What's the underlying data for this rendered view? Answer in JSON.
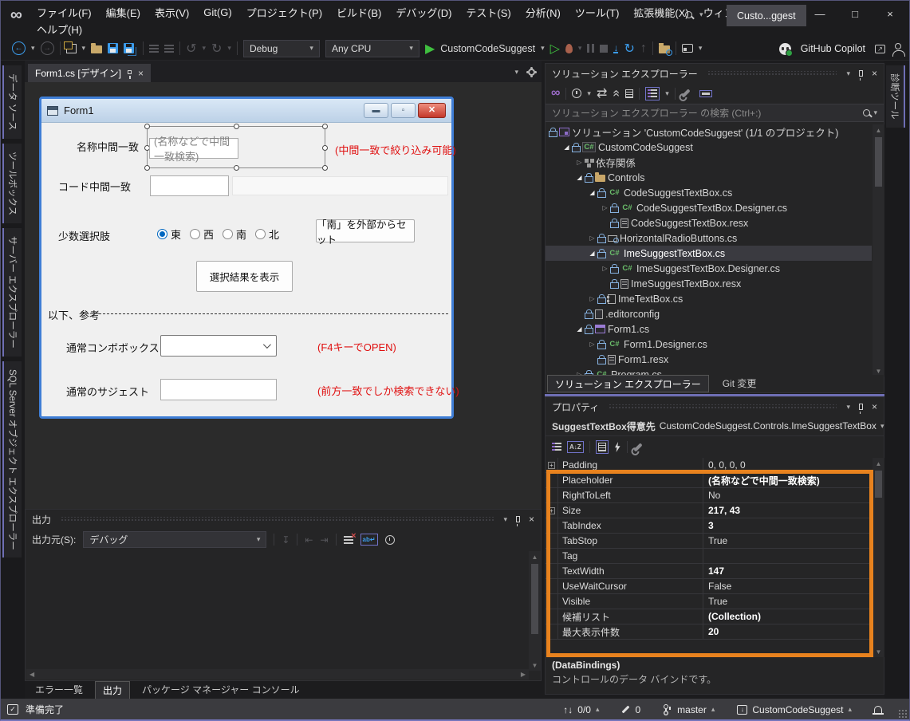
{
  "titlebar": {
    "menus": [
      "ファイル(F)",
      "編集(E)",
      "表示(V)",
      "Git(G)",
      "プロジェクト(P)",
      "ビルド(B)",
      "デバッグ(D)",
      "テスト(S)",
      "分析(N)",
      "ツール(T)",
      "拡張機能(X)",
      "ウィンドウ(W)"
    ],
    "help_menu": "ヘルプ(H)",
    "window_title": "Custo...ggest"
  },
  "toolbar": {
    "configuration": "Debug",
    "platform": "Any CPU",
    "start_project": "CustomCodeSuggest",
    "copilot_label": "GitHub Copilot"
  },
  "left_strip": {
    "tabs": [
      "データ ソース",
      "ツールボックス",
      "サーバー エクスプローラー",
      "SQL Server オブジェクト エクスプローラー"
    ]
  },
  "right_strip": {
    "tabs": [
      "診断ツール"
    ]
  },
  "editor": {
    "tab_label": "Form1.cs [デザイン]",
    "form": {
      "title": "Form1",
      "label_name_match": "名称中間一致",
      "placeholder_name_match": "(名称などで中間一致検索)",
      "note_name_match": "(中間一致で絞り込み可能)",
      "label_code_match": "コード中間一致",
      "label_few_choices": "少数選択肢",
      "radio_options": [
        "東",
        "西",
        "南",
        "北"
      ],
      "radio_selected": "東",
      "button_set_south": "「南」を外部からセット",
      "button_show_result": "選択結果を表示",
      "divider_label": "以下、参考",
      "label_normal_combo": "通常コンボボックス",
      "note_normal_combo": "(F4キーでOPEN)",
      "label_normal_suggest": "通常のサジェスト",
      "note_normal_suggest": "(前方一致でしか検索できない)"
    }
  },
  "solution_explorer": {
    "title": "ソリューション エクスプローラー",
    "search_placeholder": "ソリューション エクスプローラー の検索 (Ctrl+:)",
    "tree": [
      {
        "label": "ソリューション 'CustomCodeSuggest' (1/1 のプロジェクト)",
        "icon": "solution",
        "indent": 0,
        "arrow": "none",
        "lock": true,
        "selected": false
      },
      {
        "label": "CustomCodeSuggest",
        "icon": "csproj",
        "indent": 1,
        "arrow": "expanded",
        "lock": true,
        "selected": false
      },
      {
        "label": "依存関係",
        "icon": "dependencies",
        "indent": 2,
        "arrow": "collapsed",
        "lock": false,
        "selected": false
      },
      {
        "label": "Controls",
        "icon": "folder",
        "indent": 2,
        "arrow": "expanded",
        "lock": true,
        "selected": false
      },
      {
        "label": "CodeSuggestTextBox.cs",
        "icon": "cs",
        "indent": 3,
        "arrow": "expanded",
        "lock": true,
        "selected": false
      },
      {
        "label": "CodeSuggestTextBox.Designer.cs",
        "icon": "cs",
        "indent": 4,
        "arrow": "collapsed",
        "lock": true,
        "selected": false
      },
      {
        "label": "CodeSuggestTextBox.resx",
        "icon": "resx",
        "indent": 4,
        "arrow": "none",
        "lock": true,
        "selected": false
      },
      {
        "label": "HorizontalRadioButtons.cs",
        "icon": "usercontrol",
        "indent": 3,
        "arrow": "collapsed",
        "lock": true,
        "selected": false
      },
      {
        "label": "ImeSuggestTextBox.cs",
        "icon": "cs",
        "indent": 3,
        "arrow": "expanded",
        "lock": true,
        "selected": true
      },
      {
        "label": "ImeSuggestTextBox.Designer.cs",
        "icon": "cs",
        "indent": 4,
        "arrow": "collapsed",
        "lock": true,
        "selected": false
      },
      {
        "label": "ImeSuggestTextBox.resx",
        "icon": "resx",
        "indent": 4,
        "arrow": "none",
        "lock": true,
        "selected": false
      },
      {
        "label": "ImeTextBox.cs",
        "icon": "component",
        "indent": 3,
        "arrow": "collapsed",
        "lock": true,
        "selected": false
      },
      {
        "label": ".editorconfig",
        "icon": "file",
        "indent": 2,
        "arrow": "none",
        "lock": true,
        "selected": false
      },
      {
        "label": "Form1.cs",
        "icon": "form",
        "indent": 2,
        "arrow": "expanded",
        "lock": true,
        "selected": false
      },
      {
        "label": "Form1.Designer.cs",
        "icon": "cs",
        "indent": 3,
        "arrow": "collapsed",
        "lock": true,
        "selected": false
      },
      {
        "label": "Form1.resx",
        "icon": "resx",
        "indent": 3,
        "arrow": "none",
        "lock": true,
        "selected": false
      },
      {
        "label": "Program.cs",
        "icon": "cs",
        "indent": 2,
        "arrow": "collapsed",
        "lock": true,
        "selected": false
      }
    ],
    "tabs": [
      {
        "label": "ソリューション エクスプローラー",
        "active": true
      },
      {
        "label": "Git 変更",
        "active": false
      }
    ]
  },
  "properties": {
    "title": "プロパティ",
    "object_name": "SuggestTextBox得意先",
    "object_type": "CustomCodeSuggest.Controls.ImeSuggestTextBox",
    "rows": [
      {
        "name": "Padding",
        "value": "0, 0, 0, 0",
        "bold": false,
        "expander": true
      },
      {
        "name": "Placeholder",
        "value": "(名称などで中間一致検索)",
        "bold": true,
        "expander": false
      },
      {
        "name": "RightToLeft",
        "value": "No",
        "bold": false,
        "expander": false
      },
      {
        "name": "Size",
        "value": "217, 43",
        "bold": true,
        "expander": true
      },
      {
        "name": "TabIndex",
        "value": "3",
        "bold": true,
        "expander": false
      },
      {
        "name": "TabStop",
        "value": "True",
        "bold": false,
        "expander": false
      },
      {
        "name": "Tag",
        "value": "",
        "bold": false,
        "expander": false
      },
      {
        "name": "TextWidth",
        "value": "147",
        "bold": true,
        "expander": false
      },
      {
        "name": "UseWaitCursor",
        "value": "False",
        "bold": false,
        "expander": false
      },
      {
        "name": "Visible",
        "value": "True",
        "bold": false,
        "expander": false
      },
      {
        "name": "候補リスト",
        "value": "(Collection)",
        "bold": true,
        "expander": false
      },
      {
        "name": "最大表示件数",
        "value": "20",
        "bold": true,
        "expander": false
      }
    ],
    "description_title": "(DataBindings)",
    "description_text": "コントロールのデータ バインドです。",
    "highlight_color": "#E8821E"
  },
  "output": {
    "title": "出力",
    "source_label": "出力元(S):",
    "source_value": "デバッグ"
  },
  "bottom_tabs": [
    {
      "label": "エラー一覧",
      "active": false
    },
    {
      "label": "出力",
      "active": true
    },
    {
      "label": "パッケージ マネージャー コンソール",
      "active": false
    }
  ],
  "statusbar": {
    "ready": "準備完了",
    "sync_count": "0/0",
    "pending_edits": "0",
    "branch": "master",
    "repository": "CustomCodeSuggest"
  },
  "colors": {
    "accent_purple": "#7173C9",
    "highlight_orange": "#E8821E",
    "run_green": "#3FBF3F",
    "icon_blue": "#3B9BEA"
  }
}
